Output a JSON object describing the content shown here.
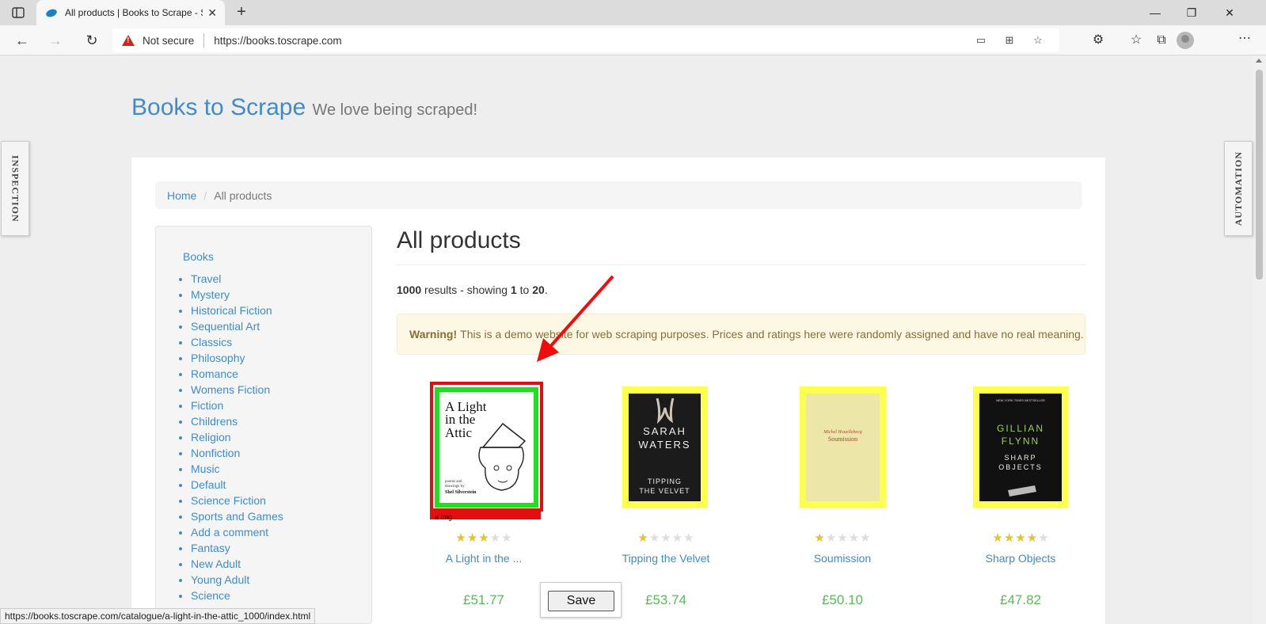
{
  "browser": {
    "tab_title": "All products | Books to Scrape - Sandbox",
    "security_label": "Not secure",
    "url": "https://books.toscrape.com",
    "status_url": "https://books.toscrape.com/catalogue/a-light-in-the-attic_1000/index.html"
  },
  "side_panels": {
    "left": "INSPECTION",
    "right": "AUTOMATION"
  },
  "site": {
    "brand": "Books to Scrape",
    "tagline": "We love being scraped!"
  },
  "breadcrumb": {
    "home": "Home",
    "current": "All products"
  },
  "sidebar": {
    "root": "Books",
    "categories": [
      "Travel",
      "Mystery",
      "Historical Fiction",
      "Sequential Art",
      "Classics",
      "Philosophy",
      "Romance",
      "Womens Fiction",
      "Fiction",
      "Childrens",
      "Religion",
      "Nonfiction",
      "Music",
      "Default",
      "Science Fiction",
      "Sports and Games",
      "Add a comment",
      "Fantasy",
      "New Adult",
      "Young Adult",
      "Science"
    ]
  },
  "main": {
    "heading": "All products",
    "results": {
      "total": "1000",
      "middle": " results - showing ",
      "from": "1",
      "to_word": " to ",
      "to": "20",
      "end": "."
    },
    "alert": {
      "strong": "Warning!",
      "text": "This is a demo website for web scraping purposes. Prices and ratings here were randomly assigned and have no real meaning."
    }
  },
  "products": [
    {
      "title": "A Light in the ...",
      "price": "£51.77",
      "rating": 3
    },
    {
      "title": "Tipping the Velvet",
      "price": "£53.74",
      "rating": 1
    },
    {
      "title": "Soumission",
      "price": "£50.10",
      "rating": 1
    },
    {
      "title": "Sharp Objects",
      "price": "£47.82",
      "rating": 4
    }
  ],
  "covers": {
    "attic": {
      "line1": "A Light",
      "line2": "in the",
      "line3": "Attic",
      "credit1": "poems and",
      "credit2": "drawings by",
      "author": "Shel Silverstein"
    },
    "velvet": {
      "author1": "SARAH",
      "author2": "WATERS",
      "title1": "TIPPING",
      "title2": "THE VELVET"
    },
    "soumission": {
      "author": "Michel Houellebecq",
      "title": "Soumission"
    },
    "sharp": {
      "top": "NEW YORK TIMES BESTSELLER",
      "author1": "GILLIAN",
      "author2": "FLYNN",
      "title1": "SHARP",
      "title2": "OBJECTS"
    }
  },
  "overlay": {
    "img_label": "a img",
    "save_button": "Save"
  },
  "colors": {
    "link": "#428bca",
    "price": "#5cb85c",
    "highlight_red": "#e01010",
    "highlight_green": "#1ee01e",
    "highlight_yellow": "#ffff4d"
  }
}
